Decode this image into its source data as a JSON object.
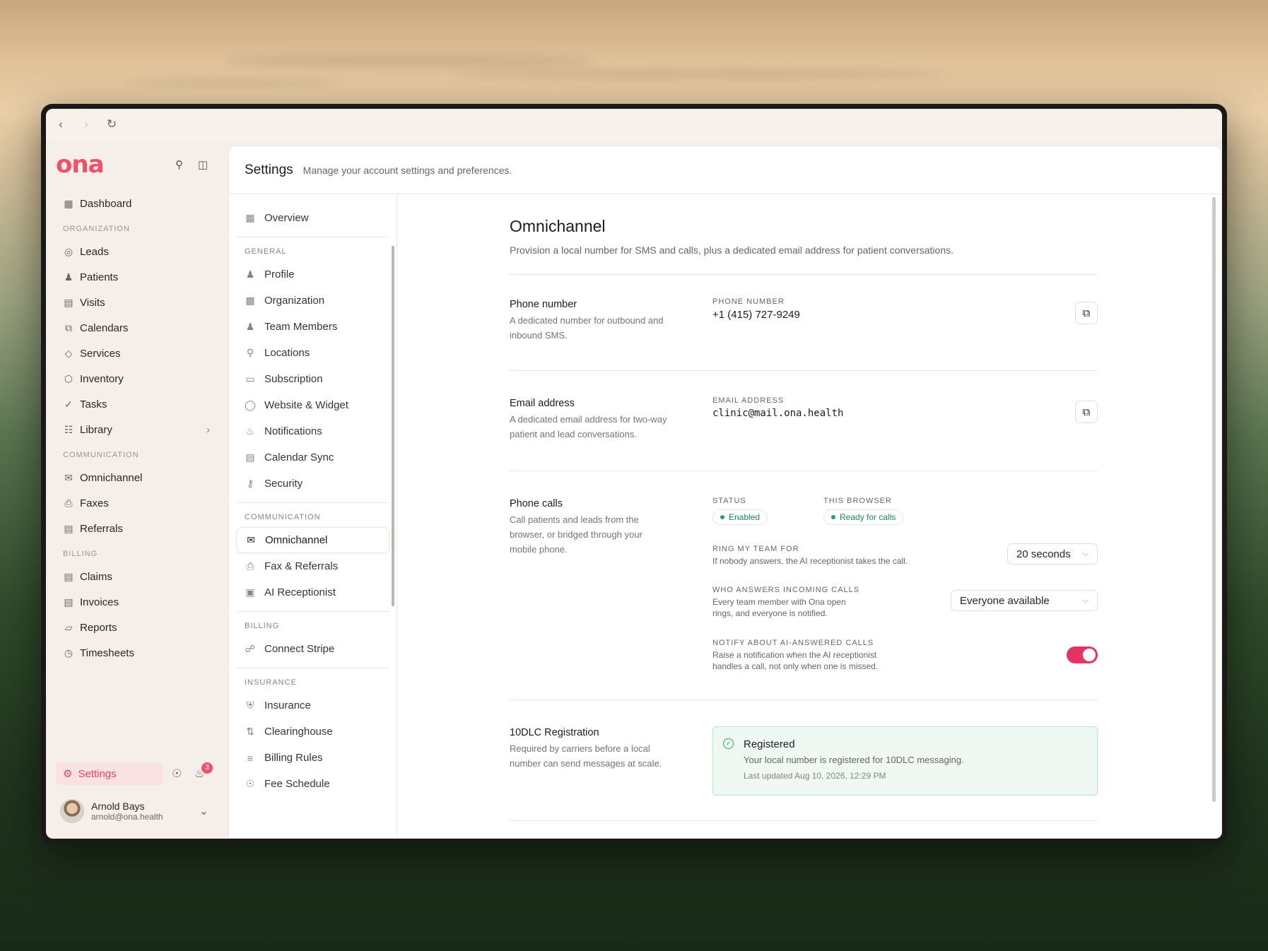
{
  "browser": {
    "back_icon": "chevron-left-icon",
    "forward_icon": "chevron-right-icon",
    "reload_icon": "reload-icon"
  },
  "brand": {
    "logo_text": "ona",
    "accent": "#f0506a"
  },
  "sidebar": {
    "top_item": {
      "label": "Dashboard",
      "icon": "grid-icon"
    },
    "sections": [
      {
        "title": "ORGANIZATION",
        "items": [
          {
            "label": "Leads",
            "icon": "target-icon"
          },
          {
            "label": "Patients",
            "icon": "users-icon"
          },
          {
            "label": "Visits",
            "icon": "calendar-icon"
          },
          {
            "label": "Calendars",
            "icon": "calendars-icon"
          },
          {
            "label": "Services",
            "icon": "tag-icon"
          },
          {
            "label": "Inventory",
            "icon": "box-icon"
          },
          {
            "label": "Tasks",
            "icon": "check-circle-icon"
          },
          {
            "label": "Library",
            "icon": "library-icon"
          }
        ]
      },
      {
        "title": "COMMUNICATION",
        "items": [
          {
            "label": "Omnichannel",
            "icon": "chat-icon"
          },
          {
            "label": "Faxes",
            "icon": "printer-icon"
          },
          {
            "label": "Referrals",
            "icon": "document-icon"
          }
        ]
      },
      {
        "title": "BILLING",
        "items": [
          {
            "label": "Claims",
            "icon": "document-icon"
          },
          {
            "label": "Invoices",
            "icon": "receipt-icon"
          },
          {
            "label": "Reports",
            "icon": "chart-icon"
          },
          {
            "label": "Timesheets",
            "icon": "clock-icon"
          }
        ]
      }
    ],
    "settings_label": "Settings",
    "notification_count": "3",
    "user": {
      "name": "Arnold Bays",
      "email": "arnold@ona.health"
    }
  },
  "header": {
    "title": "Settings",
    "subtitle": "Manage your account settings and preferences."
  },
  "settings_nav": {
    "overview": "Overview",
    "general_title": "GENERAL",
    "general": [
      "Profile",
      "Organization",
      "Team Members",
      "Locations",
      "Subscription",
      "Website & Widget",
      "Notifications",
      "Calendar Sync",
      "Security"
    ],
    "communication_title": "COMMUNICATION",
    "communication": [
      "Omnichannel",
      "Fax & Referrals",
      "AI Receptionist"
    ],
    "billing_title": "BILLING",
    "billing": [
      "Connect Stripe"
    ],
    "insurance_title": "INSURANCE",
    "insurance": [
      "Insurance",
      "Clearinghouse",
      "Billing Rules",
      "Fee Schedule"
    ]
  },
  "content": {
    "title": "Omnichannel",
    "subtitle": "Provision a local number for SMS and calls, plus a dedicated email address for patient conversations.",
    "phone": {
      "title": "Phone number",
      "desc": "A dedicated number for outbound and inbound SMS.",
      "label": "PHONE NUMBER",
      "value": "+1 (415) 727-9249"
    },
    "email": {
      "title": "Email address",
      "desc": "A dedicated email address for two-way patient and lead conversations.",
      "label": "EMAIL ADDRESS",
      "value": "clinic@mail.ona.health"
    },
    "calls": {
      "title": "Phone calls",
      "desc": "Call patients and leads from the browser, or bridged through your mobile phone.",
      "status_label": "STATUS",
      "status_value": "Enabled",
      "browser_label": "THIS BROWSER",
      "browser_value": "Ready for calls",
      "ring_label": "RING MY TEAM FOR",
      "ring_hint": "If nobody answers, the AI receptionist takes the call.",
      "ring_value": "20 seconds",
      "who_label": "WHO ANSWERS INCOMING CALLS",
      "who_hint": "Every team member with Ona open rings, and everyone is notified.",
      "who_value": "Everyone available",
      "notify_label": "NOTIFY ABOUT AI-ANSWERED CALLS",
      "notify_hint": "Raise a notification when the AI receptionist handles a call, not only when one is missed.",
      "notify_on": true
    },
    "tendlc": {
      "title": "10DLC Registration",
      "desc": "Required by carriers before a local number can send messages at scale.",
      "status": "Registered",
      "message": "Your local number is registered for 10DLC messaging.",
      "updated": "Last updated Aug 10, 2026, 12:29 PM"
    }
  }
}
